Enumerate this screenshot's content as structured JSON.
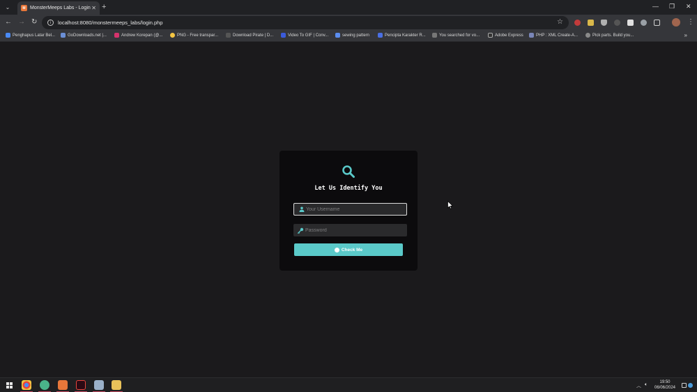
{
  "browser": {
    "tab": {
      "title": "MonsterMeeps Labs - Login",
      "favicon_text": "M"
    },
    "url": "localhost:8080/monstermeeps_labs/login.php",
    "bookmarks": [
      {
        "label": "Penghapus Latar Bel...",
        "color": "#4a8af4"
      },
      {
        "label": "GoDownloads.net |...",
        "color": "#6b8fd6"
      },
      {
        "label": "Andrew Korepan (@...",
        "color": "#d6336c"
      },
      {
        "label": "PNG - Free transpar...",
        "color": "#f4c542"
      },
      {
        "label": "Download Pirate | D...",
        "color": "#555555"
      },
      {
        "label": "Video To GIF | Conv...",
        "color": "#3b5bdb"
      },
      {
        "label": "sewing pattern",
        "color": "#5b8def"
      },
      {
        "label": "Pencipta Karakter R...",
        "color": "#4a6fe3"
      },
      {
        "label": "You searched for vo...",
        "color": "#777777"
      },
      {
        "label": "Adobe Express",
        "color": "#333333"
      },
      {
        "label": "PHP : XML Create-A...",
        "color": "#7a86b8"
      },
      {
        "label": "Pick parts. Build you...",
        "color": "#8a8a8a"
      }
    ]
  },
  "login": {
    "title": "Let Us Identify You",
    "username_placeholder": "Your Username",
    "password_placeholder": "Password",
    "submit_label": "Check Me",
    "accent": "#5ac9c9"
  },
  "taskbar": {
    "time": "19:50",
    "date": "06/06/2024"
  }
}
